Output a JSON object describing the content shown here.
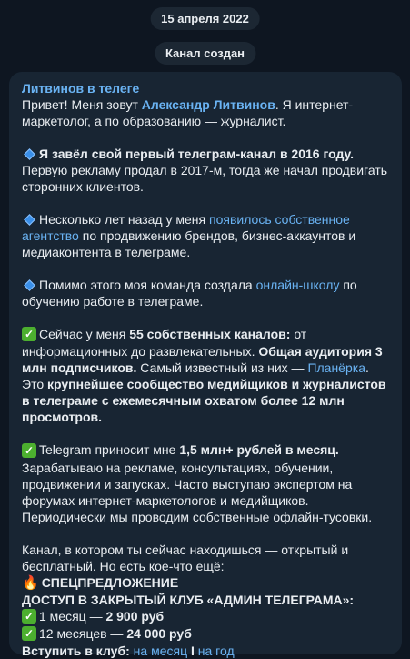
{
  "date_label": "15 апреля 2022",
  "service_message": "Канал создан",
  "channel_name": "Литвинов в телеге",
  "intro": {
    "t1": "Привет! Меня зовут ",
    "name": "Александр Литвинов",
    "t2": ". Я интернет-маркетолог, а по образованию — журналист."
  },
  "p1": {
    "bold": "Я завёл свой первый телеграм-канал в 2016 году.",
    "text": " Первую рекламу продал в 2017-м, тогда же начал продвигать сторонних клиентов."
  },
  "p2": {
    "t1": "Несколько лет назад у меня ",
    "link": "появилось собственное агентство",
    "t2": " по продвижению брендов, бизнес-аккаунтов и медиаконтента в телеграме."
  },
  "p3": {
    "t1": "Помимо этого моя команда создала ",
    "link": "онлайн-школу",
    "t2": " по обучению работе в телеграме."
  },
  "p4": {
    "t1": "Сейчас у меня ",
    "b1": "55 собственных каналов:",
    "t2": " от информационных до развлекательных. ",
    "b2": "Общая аудитория 3 млн подписчиков.",
    "t3": " Самый известный из них — ",
    "link": "Планёрка",
    "t4": ". Это ",
    "b3": "крупнейшее сообщество медийщиков и журналистов в телеграме с ежемесячным охватом более 12 млн просмотров."
  },
  "p5": {
    "t1": "Telegram приносит мне ",
    "b1": "1,5 млн+ рублей в месяц.",
    "t2": " Зарабатываю на рекламе, консультациях, обучении, продвижении и запусках. Часто выступаю экспертом на форумах интернет-маркетологов и медийщиков. Периодически мы проводим собственные офлайн-тусовки."
  },
  "p6": {
    "text": "Канал, в котором ты сейчас находишься — открытый и бесплатный. Но есть кое-что ещё:",
    "special": "СПЕЦПРЕДЛОЖЕНИЕ",
    "club": "ДОСТУП В ЗАКРЫТЫЙ КЛУБ «АДМИН ТЕЛЕГРАМА»:",
    "price1_t": "1 месяц — ",
    "price1_b": "2 900 руб",
    "price2_t": "12 месяцев — ",
    "price2_b": "24 000 руб",
    "join": "Вступить в клуб:",
    "join_month": "на месяц",
    "sep": "I",
    "join_year": "на год"
  },
  "icons": {
    "diamond": "small-blue-diamond-icon",
    "check": "check-mark-button-icon",
    "fire": "fire-icon"
  }
}
